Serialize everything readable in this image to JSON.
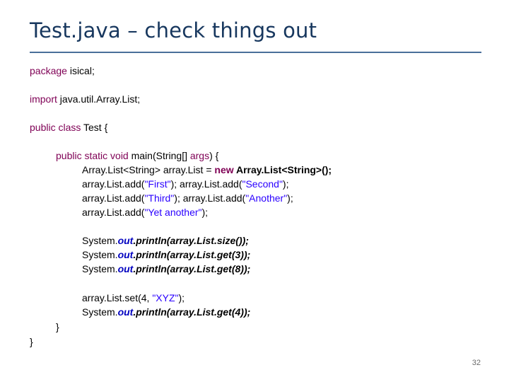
{
  "slide": {
    "title": "Test.java – check things out",
    "page_number": "32"
  },
  "code": {
    "l_package_kw": "package",
    "l_package_rest": " isical;",
    "l_import_kw": "import",
    "l_import_rest": " java.util.Array.List;",
    "l_class_kw": "public class",
    "l_class_rest": " Test {",
    "l_main_kw": "public static void",
    "l_main_rest1": " main(String[] ",
    "l_main_args": "args",
    "l_main_rest2": ") {",
    "l_decl_a": "Array.List<String> array.List = ",
    "l_decl_new": "new",
    "l_decl_b": " Array.List<String>();",
    "l_add1_a": "array.List.add(",
    "l_add1_s1": "\"First\"",
    "l_add1_b": "); array.List.add(",
    "l_add1_s2": "\"Second\"",
    "l_add1_c": ");",
    "l_add2_a": "array.List.add(",
    "l_add2_s1": "\"Third\"",
    "l_add2_b": "); array.List.add(",
    "l_add2_s2": "\"Another\"",
    "l_add2_c": ");",
    "l_add3_a": "array.List.add(",
    "l_add3_s1": "\"Yet another\"",
    "l_add3_b": ");",
    "l_p1_a": "System.",
    "l_p1_out": "out",
    "l_p1_b": ".println(array.List.size());",
    "l_p2_a": "System.",
    "l_p2_out": "out",
    "l_p2_b": ".println(array.List.get(3));",
    "l_p3_a": "System.",
    "l_p3_out": "out",
    "l_p3_b": ".println(array.List.get(8));",
    "l_set_a": "array.List.set(4, ",
    "l_set_s": "\"XYZ\"",
    "l_set_b": ");",
    "l_p4_a": "System.",
    "l_p4_out": "out",
    "l_p4_b": ".println(array.List.get(4));",
    "l_close1": "}",
    "l_close2": "}"
  }
}
